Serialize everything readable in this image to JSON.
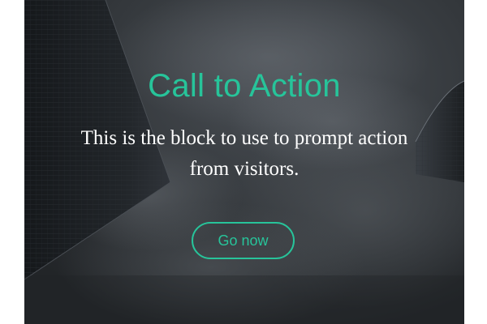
{
  "hero": {
    "title": "Call to Action",
    "text": "This is the block to use to prompt action from visitors.",
    "button_label": "Go now"
  },
  "colors": {
    "accent": "#27c49a",
    "text": "#ffffff",
    "background": "#2b2e31"
  }
}
